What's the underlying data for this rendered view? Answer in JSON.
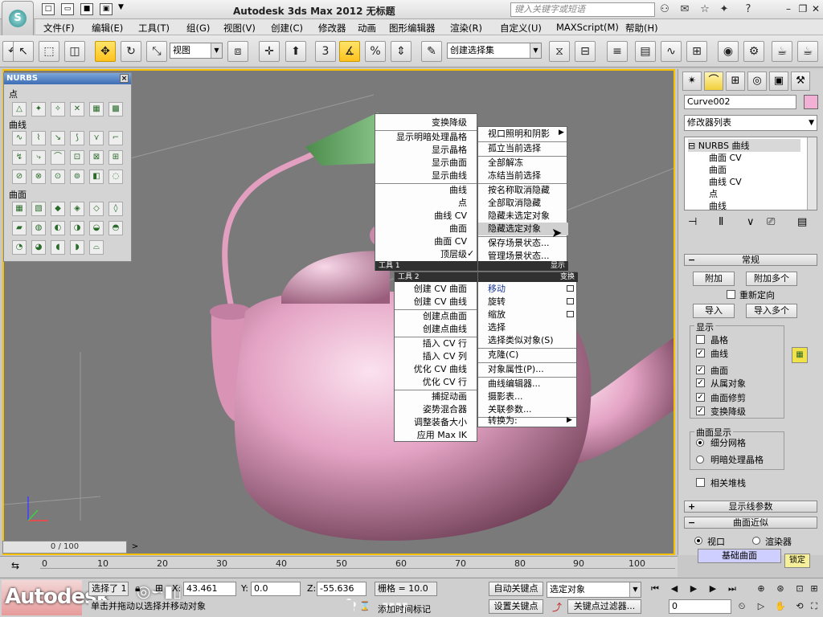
{
  "window": {
    "title": "Autodesk 3ds Max  2012   无标题",
    "help_placeholder": "键入关键字或短语"
  },
  "menu": [
    "文件(F)",
    "编辑(E)",
    "工具(T)",
    "组(G)",
    "视图(V)",
    "创建(C)",
    "修改器",
    "动画",
    "图形编辑器",
    "渲染(R)",
    "自定义(U)",
    "MAXScript(M)",
    "帮助(H)"
  ],
  "toolbar": {
    "view_dropdown": "视图",
    "selection_set": "创建选择集",
    "snap_label": "3"
  },
  "nurbs_panel": {
    "title": "NURBS",
    "close": "×",
    "sections": {
      "point": "点",
      "curve": "曲线",
      "surface": "曲面"
    }
  },
  "quad_menu": {
    "tools1": {
      "header": "工具 1",
      "header_right": "显示",
      "items": [
        "变换降级",
        "显示明暗处理晶格",
        "显示晶格",
        "显示曲面",
        "显示曲线",
        "曲线",
        "点",
        "曲线 CV",
        "曲面",
        "曲面 CV",
        "顶层级"
      ],
      "checked": "✓"
    },
    "display": {
      "items": [
        "视口照明和阴影",
        "孤立当前选择",
        "全部解冻",
        "冻结当前选择",
        "按名称取消隐藏",
        "全部取消隐藏",
        "隐藏未选定对象",
        "隐藏选定对象",
        "保存场景状态...",
        "管理场景状态..."
      ],
      "arrow": "▶"
    },
    "tools2": {
      "header": "工具 2",
      "items": [
        "创建 CV 曲面",
        "创建 CV 曲线",
        "创建点曲面",
        "创建点曲线",
        "插入 CV 行",
        "插入 CV 列",
        "优化 CV 曲线",
        "优化 CV 行",
        "捕捉动画",
        "姿势混合器",
        "调整装备大小",
        "应用 Max IK"
      ]
    },
    "transform": {
      "header": "变换",
      "items": [
        "移动",
        "旋转",
        "缩放",
        "选择",
        "选择类似对象(S)",
        "克隆(C)",
        "对象属性(P)...",
        "曲线编辑器...",
        "摄影表...",
        "关联参数...",
        "转换为:"
      ],
      "arrow": "▶"
    }
  },
  "command_panel": {
    "object_name": "Curve002",
    "modifier_list": "修改器列表",
    "stack": {
      "root": "NURBS 曲线",
      "items": [
        "曲面 CV",
        "曲面",
        "曲线 CV",
        "点",
        "曲线"
      ]
    },
    "rollouts": {
      "general": {
        "title": "常规",
        "attach": "附加",
        "attach_multiple": "附加多个",
        "reorient": "重新定向",
        "import": "导入",
        "import_multiple": "导入多个",
        "display_group": "显示",
        "display_checks": [
          "晶格",
          "曲线",
          "曲面",
          "从属对象",
          "曲面修剪",
          "变换降级"
        ],
        "surface_display_group": "曲面显示",
        "surface_display_options": [
          "细分网格",
          "明暗处理晶格"
        ],
        "related_stack": "相关堆栈"
      },
      "display_line_params": {
        "title": "显示线参数"
      },
      "surface_approx": {
        "title": "曲面近似",
        "viewport": "视口",
        "renderer": "渲染器",
        "base_surface": "基础曲面",
        "lock": "锁定"
      }
    }
  },
  "timeline": {
    "slider": "0 / 100",
    "ticks": [
      "0",
      "10",
      "20",
      "30",
      "40",
      "50",
      "60",
      "70",
      "80",
      "90",
      "100"
    ]
  },
  "statusbar": {
    "brand": "Autodesk",
    "selected": "选择了 1",
    "x_label": "X:",
    "x_value": "43.461",
    "y_label": "Y:",
    "y_value": "0.0",
    "z_label": "Z:",
    "z_value": "-55.636",
    "grid": "栅格 = 10.0",
    "auto_key": "自动关键点",
    "set_key": "设置关键点",
    "key_mode_dropdown": "选定对象",
    "key_filters": "关键点过滤器...",
    "add_time_tag": "添加时间标记",
    "prompt": "单击并拖动以选择并移动对象",
    "frame_field": "0"
  },
  "colors": {
    "viewport_border": "#f7c100",
    "teapot": "#e6a4c4",
    "handle_green": "#6aad6a"
  }
}
